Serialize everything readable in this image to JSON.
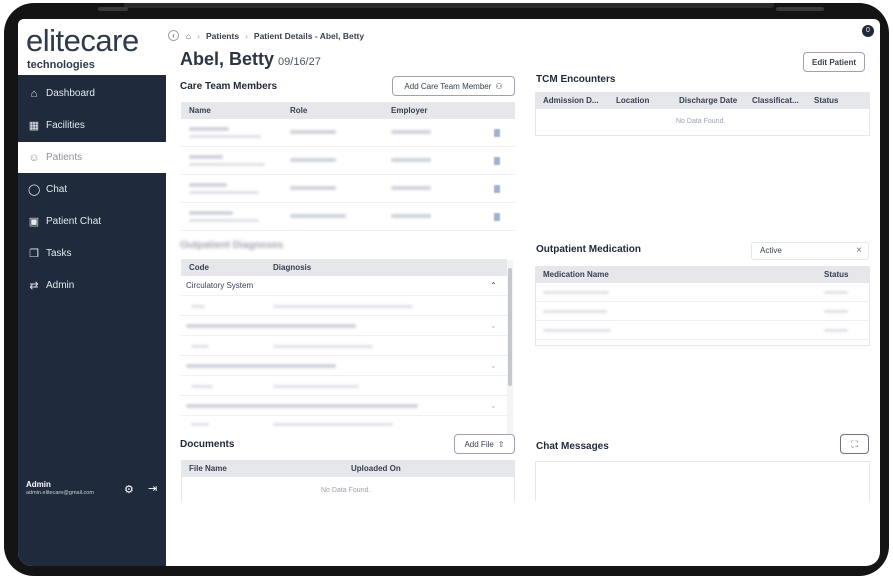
{
  "app": {
    "logo_main_1": "elite",
    "logo_main_2": "care",
    "logo_sub": "technologies"
  },
  "sidebar": {
    "items": [
      {
        "label": "Dashboard",
        "icon": "home-icon"
      },
      {
        "label": "Facilities",
        "icon": "building-icon"
      },
      {
        "label": "Patients",
        "icon": "users-icon",
        "active": true
      },
      {
        "label": "Chat",
        "icon": "chat-icon"
      },
      {
        "label": "Patient Chat",
        "icon": "patient-chat-icon"
      },
      {
        "label": "Tasks",
        "icon": "tasks-icon"
      },
      {
        "label": "Admin",
        "icon": "admin-icon"
      }
    ],
    "user": {
      "name": "Admin",
      "email": "admin.elitecare@gmail.com"
    }
  },
  "header": {
    "breadcrumb": [
      "Patients",
      "Patient Details - Abel, Betty"
    ],
    "notification_count": "0",
    "patient_name": "Abel, Betty",
    "patient_dob": "09/16/27",
    "edit_label": "Edit Patient"
  },
  "care_team": {
    "title": "Care Team Members",
    "add_label": "Add Care Team Member",
    "columns": [
      "Name",
      "Role",
      "Employer"
    ],
    "row_count": 4
  },
  "diagnoses": {
    "title": "Outpatient Diagnoses",
    "columns": [
      "Code",
      "Diagnosis"
    ],
    "first_group": "Circulatory System"
  },
  "documents": {
    "title": "Documents",
    "add_label": "Add File",
    "columns": [
      "File Name",
      "Uploaded On"
    ],
    "empty": "No Data Found."
  },
  "tcm": {
    "title": "TCM Encounters",
    "columns": [
      "Admission D...",
      "Location",
      "Discharge Date",
      "Classificat...",
      "Status"
    ],
    "empty": "No Data Found."
  },
  "medication": {
    "title": "Outpatient Medication",
    "filter_value": "Active",
    "columns": [
      "Medication Name",
      "Status"
    ]
  },
  "chat": {
    "title": "Chat Messages"
  },
  "colors": {
    "sidebar_bg": "#1f2b3c",
    "logo_accent": "#e85a2a",
    "header_row_bg": "#e5e7eb"
  }
}
